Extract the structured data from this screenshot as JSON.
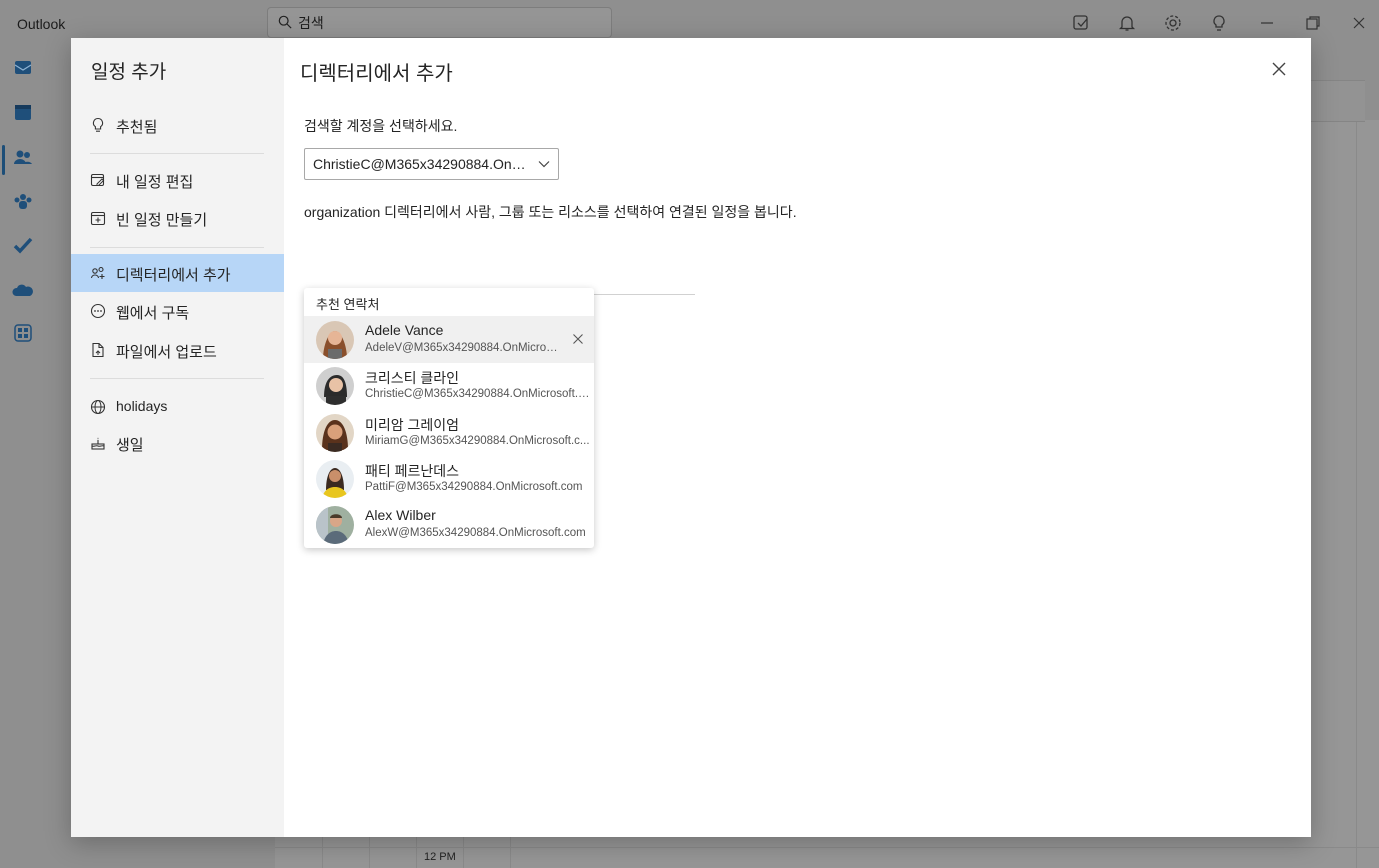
{
  "app": {
    "title": "Outlook"
  },
  "search": {
    "placeholder": "검색"
  },
  "calendar_bg": {
    "time_label": "12 PM"
  },
  "modal": {
    "nav_title": "일정 추가",
    "nav_items": [
      {
        "label": "추천됨",
        "icon": "lightbulb-icon"
      },
      {
        "label": "내 일정 편집",
        "icon": "edit-calendar-icon"
      },
      {
        "label": "빈 일정 만들기",
        "icon": "add-calendar-icon"
      },
      {
        "label": "디렉터리에서 추가",
        "icon": "people-add-icon",
        "selected": true
      },
      {
        "label": "웹에서 구독",
        "icon": "subscribe-icon"
      },
      {
        "label": "파일에서 업로드",
        "icon": "upload-file-icon"
      },
      {
        "label": "holidays",
        "icon": "globe-icon"
      },
      {
        "label": "생일",
        "icon": "cake-icon"
      }
    ],
    "content_title": "디렉터리에서 추가",
    "account_prompt": "검색할 계정을 선택하세요.",
    "account_value": "ChristieC@M365x34290884.OnMic...",
    "org_description": "organization 디렉터리에서 사람, 그룹 또는 리소스를 선택하여 연결된 일정을 봅니다.",
    "suggestions": {
      "heading": "추천 연락처",
      "contacts": [
        {
          "name": "Adele Vance",
          "email": "AdeleV@M365x34290884.OnMicros...",
          "avatar_color": "#b47a52"
        },
        {
          "name": "크리스티 클라인",
          "email": "ChristieC@M365x34290884.OnMicrosoft.c...",
          "avatar_color": "#3b3b3b"
        },
        {
          "name": "미리암 그레이엄",
          "email": "MiriamG@M365x34290884.OnMicrosoft.c...",
          "avatar_color": "#7a4a2e"
        },
        {
          "name": "패티 페르난데스",
          "email": "PattiF@M365x34290884.OnMicrosoft.com",
          "avatar_color": "#e2c23a"
        },
        {
          "name": "Alex Wilber",
          "email": "AlexW@M365x34290884.OnMicrosoft.com",
          "avatar_color": "#6a7b5a"
        }
      ]
    }
  },
  "colors": {
    "accent": "#b7d6f7",
    "rail_accent": "#1d4e78"
  }
}
